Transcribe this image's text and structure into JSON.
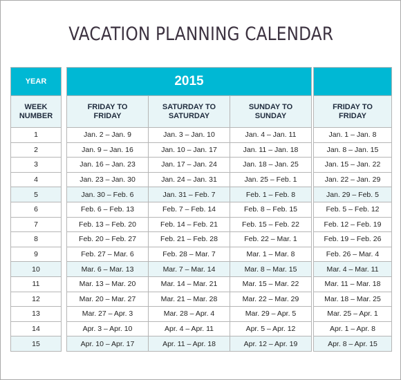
{
  "title": "VACATION PLANNING CALENDAR",
  "year_label": "YEAR",
  "year_value": "2015",
  "extra_year_value": "",
  "week_header": "WEEK\nNUMBER",
  "columns": [
    {
      "label": "FRIDAY TO FRIDAY"
    },
    {
      "label": "SATURDAY TO SATURDAY"
    },
    {
      "label": "SUNDAY TO SUNDAY"
    },
    {
      "label": "FRIDAY TO FRIDAY"
    }
  ],
  "highlight_color": "#e8f5f7",
  "accent_color": "#00b8d4",
  "rows": [
    {
      "week": "1",
      "fri": "Jan. 2 – Jan. 9",
      "sat": "Jan. 3 – Jan. 10",
      "sun": "Jan. 4 – Jan. 11",
      "fri2": "Jan. 1 – Jan. 8",
      "highlight": false
    },
    {
      "week": "2",
      "fri": "Jan. 9 – Jan. 16",
      "sat": "Jan. 10 – Jan. 17",
      "sun": "Jan. 11 – Jan. 18",
      "fri2": "Jan. 8 – Jan. 15",
      "highlight": false
    },
    {
      "week": "3",
      "fri": "Jan. 16 – Jan. 23",
      "sat": "Jan. 17 – Jan. 24",
      "sun": "Jan. 18 – Jan. 25",
      "fri2": "Jan. 15 – Jan. 22",
      "highlight": false
    },
    {
      "week": "4",
      "fri": "Jan. 23 – Jan. 30",
      "sat": "Jan. 24 – Jan. 31",
      "sun": "Jan. 25 – Feb. 1",
      "fri2": "Jan. 22 – Jan. 29",
      "highlight": false
    },
    {
      "week": "5",
      "fri": "Jan. 30 – Feb. 6",
      "sat": "Jan. 31 – Feb. 7",
      "sun": "Feb. 1 – Feb. 8",
      "fri2": "Jan. 29 – Feb. 5",
      "highlight": true
    },
    {
      "week": "6",
      "fri": "Feb. 6 – Feb. 13",
      "sat": "Feb. 7 – Feb. 14",
      "sun": "Feb. 8 – Feb. 15",
      "fri2": "Feb. 5 – Feb. 12",
      "highlight": false
    },
    {
      "week": "7",
      "fri": "Feb. 13 – Feb. 20",
      "sat": "Feb. 14 – Feb. 21",
      "sun": "Feb. 15 – Feb. 22",
      "fri2": "Feb. 12 – Feb. 19",
      "highlight": false
    },
    {
      "week": "8",
      "fri": "Feb. 20 – Feb. 27",
      "sat": "Feb. 21 – Feb. 28",
      "sun": "Feb. 22 – Mar. 1",
      "fri2": "Feb. 19 – Feb. 26",
      "highlight": false
    },
    {
      "week": "9",
      "fri": "Feb. 27 – Mar. 6",
      "sat": "Feb. 28 – Mar. 7",
      "sun": "Mar. 1 – Mar. 8",
      "fri2": "Feb. 26 – Mar. 4",
      "highlight": false
    },
    {
      "week": "10",
      "fri": "Mar. 6 – Mar. 13",
      "sat": "Mar. 7 – Mar. 14",
      "sun": "Mar. 8 – Mar. 15",
      "fri2": "Mar. 4 – Mar. 11",
      "highlight": true
    },
    {
      "week": "11",
      "fri": "Mar. 13 – Mar. 20",
      "sat": "Mar. 14 – Mar. 21",
      "sun": "Mar. 15 – Mar. 22",
      "fri2": "Mar. 11 – Mar. 18",
      "highlight": false
    },
    {
      "week": "12",
      "fri": "Mar. 20 – Mar. 27",
      "sat": "Mar. 21 – Mar. 28",
      "sun": "Mar. 22 – Mar. 29",
      "fri2": "Mar. 18 – Mar. 25",
      "highlight": false
    },
    {
      "week": "13",
      "fri": "Mar. 27 – Apr. 3",
      "sat": "Mar. 28 – Apr. 4",
      "sun": "Mar. 29 – Apr. 5",
      "fri2": "Mar. 25 – Apr. 1",
      "highlight": false
    },
    {
      "week": "14",
      "fri": "Apr. 3 – Apr. 10",
      "sat": "Apr. 4 – Apr. 11",
      "sun": "Apr. 5 – Apr. 12",
      "fri2": "Apr. 1 – Apr. 8",
      "highlight": false
    },
    {
      "week": "15",
      "fri": "Apr. 10 – Apr. 17",
      "sat": "Apr. 11 – Apr. 18",
      "sun": "Apr. 12 – Apr. 19",
      "fri2": "Apr. 8 – Apr. 15",
      "highlight": true
    }
  ]
}
